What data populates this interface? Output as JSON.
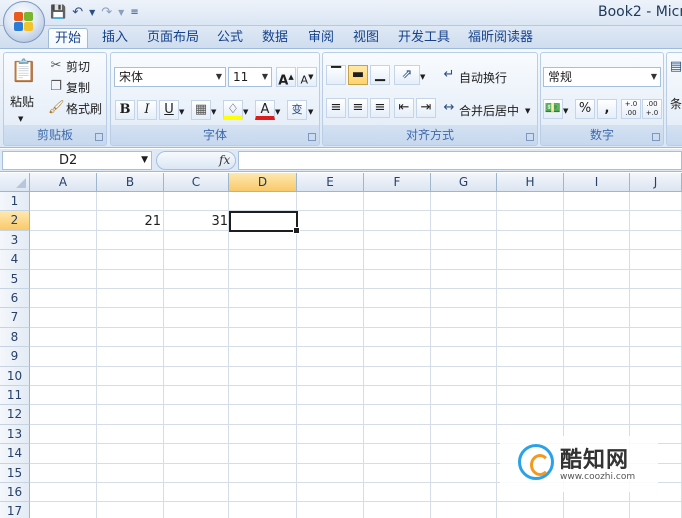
{
  "window": {
    "title": "Book2 - Micro"
  },
  "tabs": [
    {
      "label": "开始",
      "active": true
    },
    {
      "label": "插入"
    },
    {
      "label": "页面布局"
    },
    {
      "label": "公式"
    },
    {
      "label": "数据"
    },
    {
      "label": "审阅"
    },
    {
      "label": "视图"
    },
    {
      "label": "开发工具"
    },
    {
      "label": "福昕阅读器"
    }
  ],
  "ribbon": {
    "clipboard": {
      "label": "剪贴板",
      "paste": "粘贴",
      "cut": "剪切",
      "copy": "复制",
      "format_painter": "格式刷"
    },
    "font": {
      "label": "字体",
      "font_name": "宋体",
      "font_size": "11",
      "bold": "B",
      "italic": "I",
      "underline": "U",
      "wen": "变"
    },
    "alignment": {
      "label": "对齐方式",
      "wrap_text": "自动换行",
      "merge_center": "合并后居中"
    },
    "number": {
      "label": "数字",
      "format": "常规",
      "percent": "%",
      "comma": ",",
      "inc_decimal": "+.0 .00",
      "dec_decimal": ".00 +.0"
    },
    "styles": {
      "label_partial": "条"
    }
  },
  "formula_bar": {
    "name_box": "D2",
    "fx": "fx"
  },
  "grid": {
    "columns": [
      "A",
      "B",
      "C",
      "D",
      "E",
      "F",
      "G",
      "H",
      "I",
      "J"
    ],
    "rows": [
      "1",
      "2",
      "3",
      "4",
      "5",
      "6",
      "7",
      "8",
      "9",
      "10",
      "11",
      "12",
      "13",
      "14",
      "15",
      "16",
      "17"
    ],
    "selected_column": "D",
    "selected_row": "2",
    "cells": {
      "B2": "21",
      "C2": "31"
    }
  },
  "watermark": {
    "name": "酷知网",
    "url": "www.coozhi.com"
  },
  "colors": {
    "accent": "#15428b",
    "ribbon_bg": "#dbe7f5",
    "selected_header": "#f9c96a"
  }
}
